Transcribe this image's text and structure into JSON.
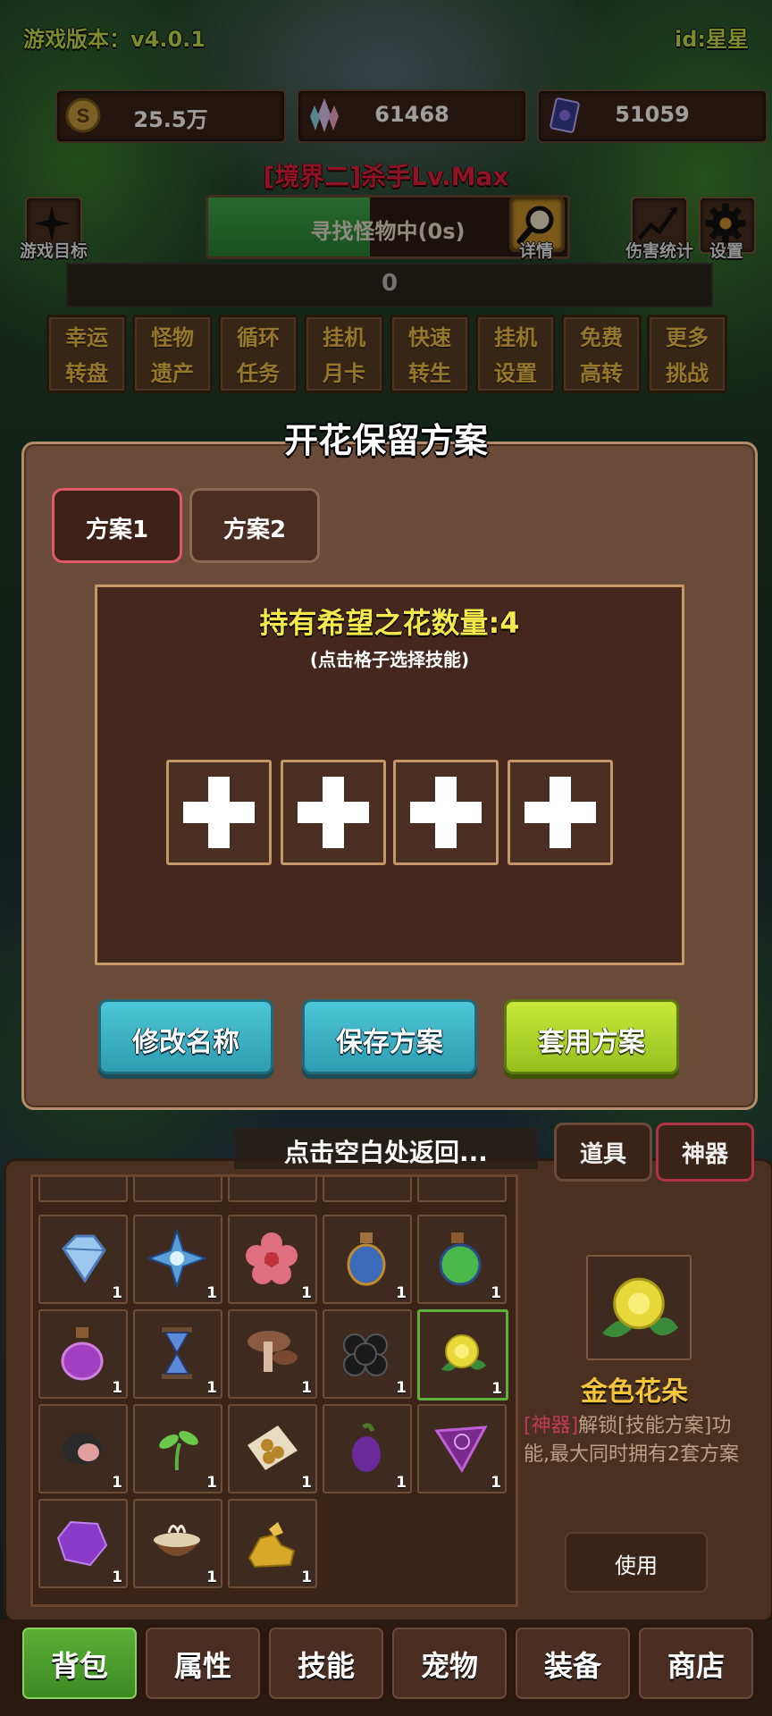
{
  "header": {
    "version": "游戏版本：v4.0.1",
    "user_id": "id:星星"
  },
  "resources": [
    {
      "icon": "coin-icon",
      "value": "25.5万"
    },
    {
      "icon": "crystal-icon",
      "value": "61468"
    },
    {
      "icon": "card-icon",
      "value": "51059"
    }
  ],
  "realm_title": "[境界二]杀手Lv.Max",
  "top_left_button": {
    "icon": "sparkle-icon",
    "label": "游戏目标"
  },
  "search": {
    "status": "寻找怪物中(0s)",
    "detail_label": "详情",
    "progress": 0.45
  },
  "top_right_buttons": [
    {
      "icon": "chart-icon",
      "label": "伤害统计"
    },
    {
      "icon": "gear-icon",
      "label": "设置"
    }
  ],
  "counter": "0",
  "menu": [
    {
      "line1": "幸运",
      "line2": "转盘"
    },
    {
      "line1": "怪物",
      "line2": "遗产"
    },
    {
      "line1": "循环",
      "line2": "任务"
    },
    {
      "line1": "挂机",
      "line2": "月卡"
    },
    {
      "line1": "快速",
      "line2": "转生"
    },
    {
      "line1": "挂机",
      "line2": "设置"
    },
    {
      "line1": "免费",
      "line2": "高转"
    },
    {
      "line1": "更多",
      "line2": "挑战"
    }
  ],
  "dialog": {
    "title": "开花保留方案",
    "tabs": [
      {
        "label": "方案1",
        "active": true
      },
      {
        "label": "方案2",
        "active": false
      }
    ],
    "hope_count": "持有希望之花数量:4",
    "hint": "(点击格子选择技能)",
    "slots": 4,
    "buttons": {
      "rename": "修改名称",
      "save": "保存方案",
      "apply": "套用方案"
    }
  },
  "tap_to_return": "点击空白处返回...",
  "inventory_tabs": [
    {
      "label": "道具",
      "active": false
    },
    {
      "label": "神器",
      "active": true
    }
  ],
  "inventory": [
    {
      "icon": "diamond-icon",
      "count": "1"
    },
    {
      "icon": "ice-star-icon",
      "count": "1"
    },
    {
      "icon": "pink-flower-icon",
      "count": "1"
    },
    {
      "icon": "blue-potion-icon",
      "count": "1"
    },
    {
      "icon": "green-potion-icon",
      "count": "1"
    },
    {
      "icon": "purple-potion-icon",
      "count": "1"
    },
    {
      "icon": "hourglass-icon",
      "count": "1"
    },
    {
      "icon": "mushroom-icon",
      "count": "1"
    },
    {
      "icon": "black-stones-icon",
      "count": "1"
    },
    {
      "icon": "golden-flower-icon",
      "count": "1"
    },
    {
      "icon": "meat-icon",
      "count": "1"
    },
    {
      "icon": "sprout-icon",
      "count": "1"
    },
    {
      "icon": "seeds-icon",
      "count": "1"
    },
    {
      "icon": "eggplant-icon",
      "count": "1"
    },
    {
      "icon": "rune-triangle-icon",
      "count": "1"
    },
    {
      "icon": "purple-gem-icon",
      "count": "1"
    },
    {
      "icon": "bowl-icon",
      "count": "1"
    },
    {
      "icon": "gold-ore-icon",
      "count": "1"
    }
  ],
  "selected_item": {
    "icon": "golden-flower-icon",
    "name": "金色花朵",
    "tag": "[神器]",
    "desc": "解锁[技能方案]功能,最大同时拥有2套方案",
    "use_label": "使用"
  },
  "bottom_nav": [
    {
      "label": "背包",
      "active": true
    },
    {
      "label": "属性",
      "active": false
    },
    {
      "label": "技能",
      "active": false
    },
    {
      "label": "宠物",
      "active": false
    },
    {
      "label": "装备",
      "active": false
    },
    {
      "label": "商店",
      "active": false
    }
  ],
  "colors": {
    "accent_yellow": "#f4e84a",
    "realm_red": "#e3213b",
    "teal_button": "#3cb4c6",
    "lime_button": "#b2d82c",
    "item_name": "#f4c43a"
  }
}
